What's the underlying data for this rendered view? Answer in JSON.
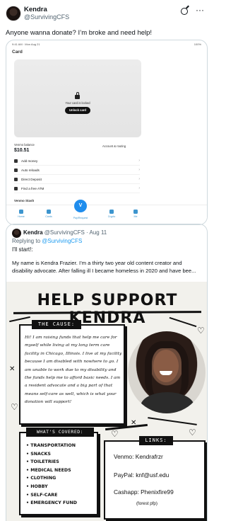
{
  "tweet": {
    "name": "Kendra",
    "handle": "@SurvivingCFS",
    "text": "Anyone wanna donate? I’m broke and need help!"
  },
  "phone": {
    "status_left": "9:41 AM · Mon Aug 21",
    "status_right": "100%",
    "title": "Card",
    "card_locked_text": "Your card is locked",
    "unlock_label": "Unlock card",
    "balance_label": "Venmo balance",
    "balance_value": "$10.51",
    "account_routing_label": "Account & routing",
    "menu": [
      {
        "icon": "add-money-icon",
        "label": "Add money"
      },
      {
        "icon": "auto-reload-icon",
        "label": "Auto reloads"
      },
      {
        "icon": "direct-deposit-icon",
        "label": "Direct Deposit"
      },
      {
        "icon": "atm-icon",
        "label": "Find a free ATM"
      }
    ],
    "user_label": "Venmo Stash",
    "tabs": [
      "Home",
      "Cards",
      "Pay/Request",
      "Crypto",
      "Me"
    ]
  },
  "quote": {
    "name": "Kendra",
    "handle_meta": "@SurvivingCFS · Aug 11",
    "replying_prefix": "Replying to",
    "replying_handle": "@SurvivingCFS",
    "line1": "I'll start!:",
    "body1": "My name is Kendra Frazier. I’m a thirty two year old content creator and",
    "body2": "disability advocate. After falling ill I became homeless in 2020 and have bee..."
  },
  "flyer": {
    "title": "HELP SUPPORT KENDRA",
    "cause_label": "THE CAUSE:",
    "cause_text": "Hi! I am raising funds that help me care for myself while living at my long term care facility in Chicago, Illinois. I live at my facility because I am disabled with nowhere to go. I am unable to work due to my disability and the funds help me to afford basic needs. I am a resident advocate and a big part of that means self-care as well, which is what your donation will support!",
    "covered_label": "WHAT'S COVERED:",
    "covered_items": [
      "TRANSPORTATION",
      "SNACKS",
      "TOILETRIES",
      "MEDICAL NEEDS",
      "CLOTHING",
      "HOBBY",
      "SELF-CARE",
      "EMERGENCY FUND"
    ],
    "links_label": "LINKS:",
    "venmo": "Venmo: Kendrafrzr",
    "paypal": "PayPal: knf@usf.edu",
    "cashapp": "Cashapp: Phenixfire99",
    "note": "(forest pfp)"
  }
}
